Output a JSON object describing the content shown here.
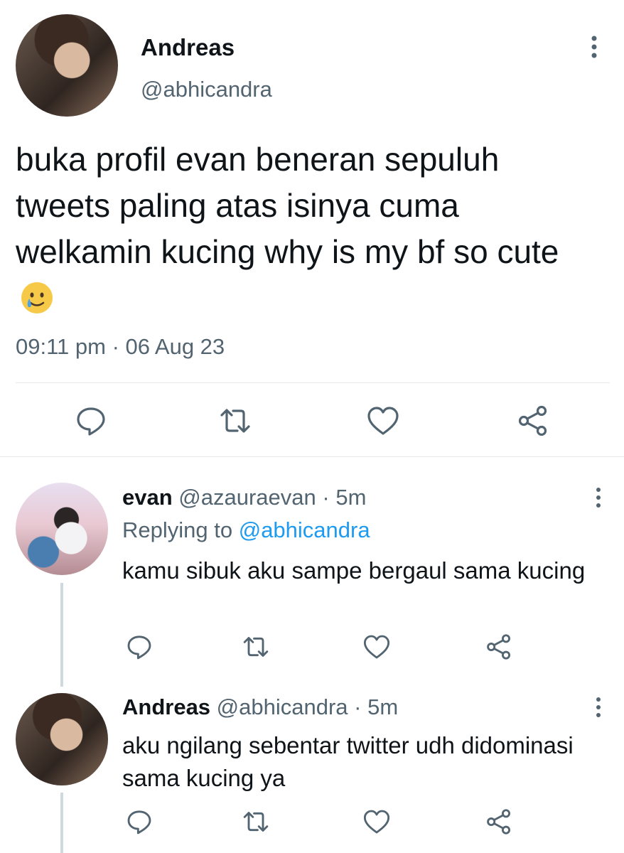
{
  "tweet": {
    "name": "Andreas",
    "handle": "@abhicandra",
    "text": "buka profil evan beneran sepuluh tweets paling atas isinya cuma welkamin kucing why is my bf so cute",
    "emoji": "🥲",
    "time": "09:11 pm",
    "separator": "·",
    "date": "06 Aug 23"
  },
  "replies": [
    {
      "name": "evan",
      "handle": "@azauraevan",
      "separator": "·",
      "time": "5m",
      "replying_prefix": "Replying to",
      "replying_to": "@abhicandra",
      "text": "kamu sibuk aku sampe bergaul sama kucing"
    },
    {
      "name": "Andreas",
      "handle": "@abhicandra",
      "separator": "·",
      "time": "5m",
      "text": "aku ngilang sebentar twitter udh didominasi sama kucing ya"
    }
  ],
  "icons": {
    "reply": "comment-icon",
    "retweet": "retweet-icon",
    "like": "heart-icon",
    "share": "share-icon",
    "more": "more-vertical-icon"
  },
  "colors": {
    "text": "#0f1419",
    "secondary": "#536471",
    "link": "#1d9bf0",
    "divider": "#e6e9ec",
    "icon": "#536471"
  }
}
